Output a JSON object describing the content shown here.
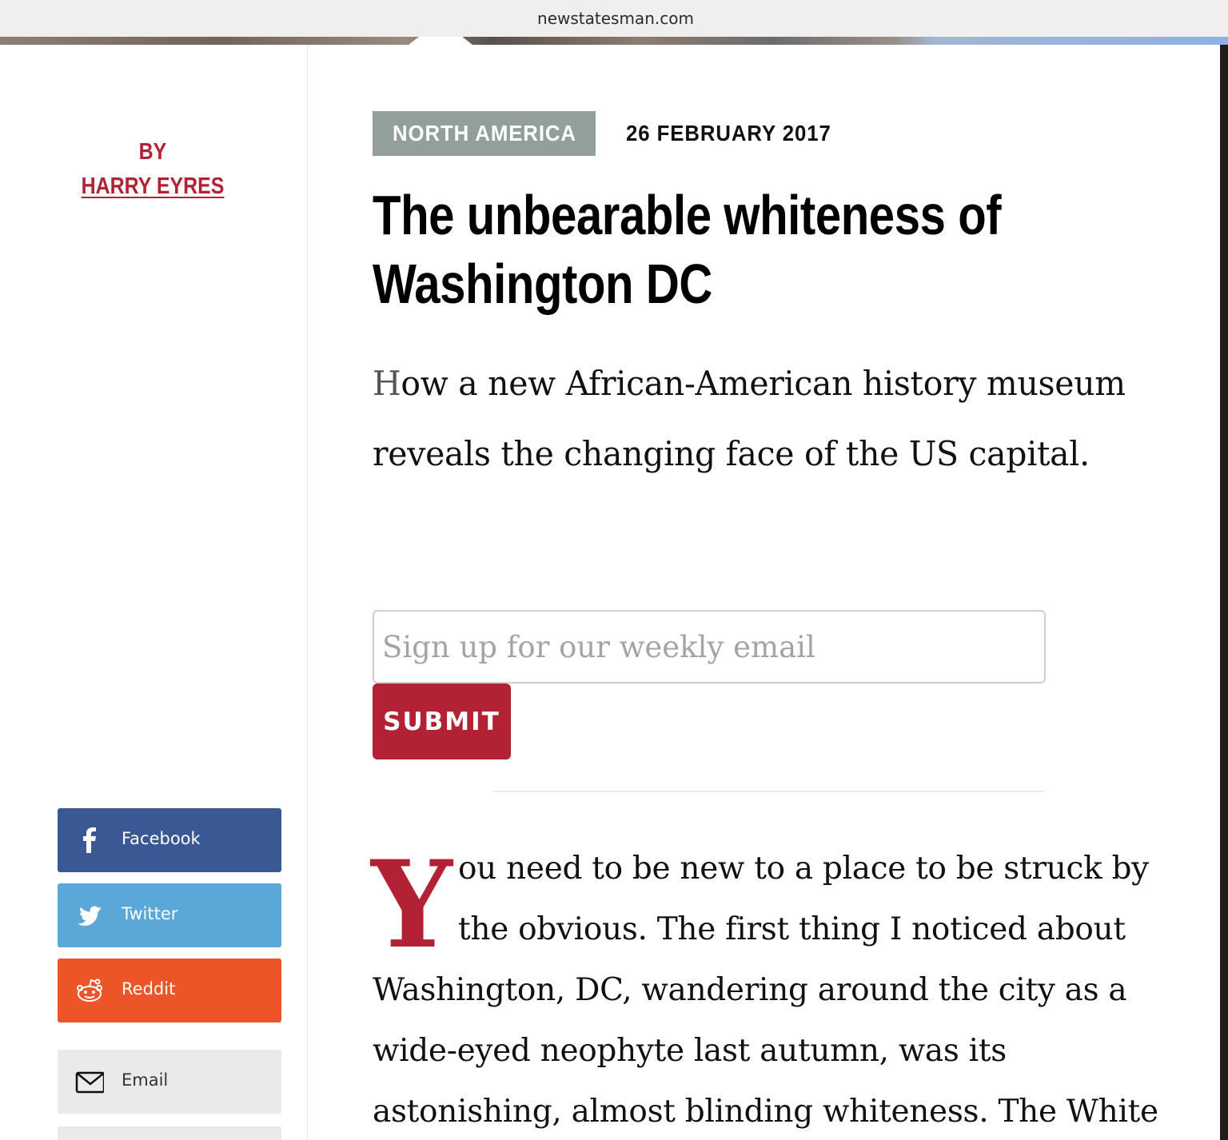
{
  "browser": {
    "url": "newstatesman.com"
  },
  "byline": {
    "by": "BY",
    "author": "HARRY EYRES"
  },
  "share": {
    "facebook": "Facebook",
    "twitter": "Twitter",
    "reddit": "Reddit",
    "email": "Email"
  },
  "article": {
    "section": "NORTH AMERICA",
    "date": "26 FEBRUARY 2017",
    "headline": "The unbearable whiteness of Washington DC",
    "standfirst_first_letter": "H",
    "standfirst_rest": "ow a new African-American history museum reveals the changing face of the US capital.",
    "drop_cap": "Y",
    "body_lines": [
      "ou need to be new to a place to be struck by",
      "the obvious. The first thing I noticed about",
      "Washington, DC, wandering around the city as a",
      "wide-eyed neophyte last autumn, was its",
      "astonishing, almost blinding whiteness. The White"
    ]
  },
  "signup": {
    "placeholder": "Sign up for our weekly email",
    "value": "",
    "submit": "SUBMIT"
  },
  "colors": {
    "brand_red": "#b22234",
    "tag_grey": "#93a09a",
    "facebook": "#3a5894",
    "twitter": "#5ba7d7",
    "reddit": "#ec5528",
    "email_bg": "#eaeaea"
  }
}
